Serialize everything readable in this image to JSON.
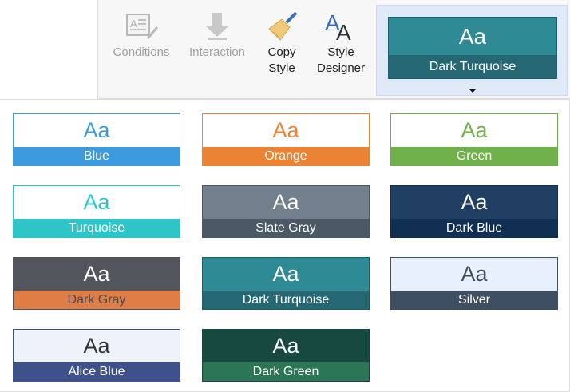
{
  "ribbon": {
    "conditions_label": "Conditions",
    "interaction_label": "Interaction",
    "copy_style_label_1": "Copy",
    "copy_style_label_2": "Style",
    "style_designer_label_1": "Style",
    "style_designer_label_2": "Designer"
  },
  "current_style": {
    "sample": "Aa",
    "name": "Dark Turquoise",
    "top_color": "#2e8a94",
    "bottom_color": "#256874"
  },
  "styles": [
    {
      "name": "Blue",
      "sample": "Aa",
      "top": "#ffffff",
      "bottom": "#3d9ade",
      "border": "#3d9ade",
      "sample_color": "#3d9ade",
      "name_color": "#ffffff"
    },
    {
      "name": "Orange",
      "sample": "Aa",
      "top": "#ffffff",
      "bottom": "#ec8233",
      "border": "#ec8233",
      "sample_color": "#ec8233",
      "name_color": "#ffffff"
    },
    {
      "name": "Green",
      "sample": "Aa",
      "top": "#ffffff",
      "bottom": "#70b04a",
      "border": "#70b04a",
      "sample_color": "#70b04a",
      "name_color": "#ffffff"
    },
    {
      "name": "Turquoise",
      "sample": "Aa",
      "top": "#ffffff",
      "bottom": "#2ec5c9",
      "border": "#2ec5c9",
      "sample_color": "#2ec5c9",
      "name_color": "#ffffff"
    },
    {
      "name": "Slate Gray",
      "sample": "Aa",
      "top": "#727f8c",
      "bottom": "#4b5866",
      "border": "#4b5866",
      "sample_color": "#ffffff",
      "name_color": "#ffffff"
    },
    {
      "name": "Dark Blue",
      "sample": "Aa",
      "top": "#213e63",
      "bottom": "#112e53",
      "border": "#112e53",
      "sample_color": "#ffffff",
      "name_color": "#ffffff"
    },
    {
      "name": "Dark Gray",
      "sample": "Aa",
      "top": "#53555c",
      "bottom": "#e07d46",
      "border": "#53555c",
      "sample_color": "#ffffff",
      "name_color": "#4a4a4a"
    },
    {
      "name": "Dark Turquoise",
      "sample": "Aa",
      "top": "#2e8a94",
      "bottom": "#256874",
      "border": "#1c5e68",
      "sample_color": "#ffffff",
      "name_color": "#ffffff"
    },
    {
      "name": "Silver",
      "sample": "Aa",
      "top": "#e8f1fb",
      "bottom": "#3e4f61",
      "border": "#3e4f61",
      "sample_color": "#3e4f61",
      "name_color": "#ffffff"
    },
    {
      "name": "Alice Blue",
      "sample": "Aa",
      "top": "#eef3fb",
      "bottom": "#3e518a",
      "border": "#3e518a",
      "sample_color": "#333333",
      "name_color": "#ffffff"
    },
    {
      "name": "Dark Green",
      "sample": "Aa",
      "top": "#17493f",
      "bottom": "#2b7755",
      "border": "#17493f",
      "sample_color": "#ffffff",
      "name_color": "#ffffff"
    }
  ]
}
